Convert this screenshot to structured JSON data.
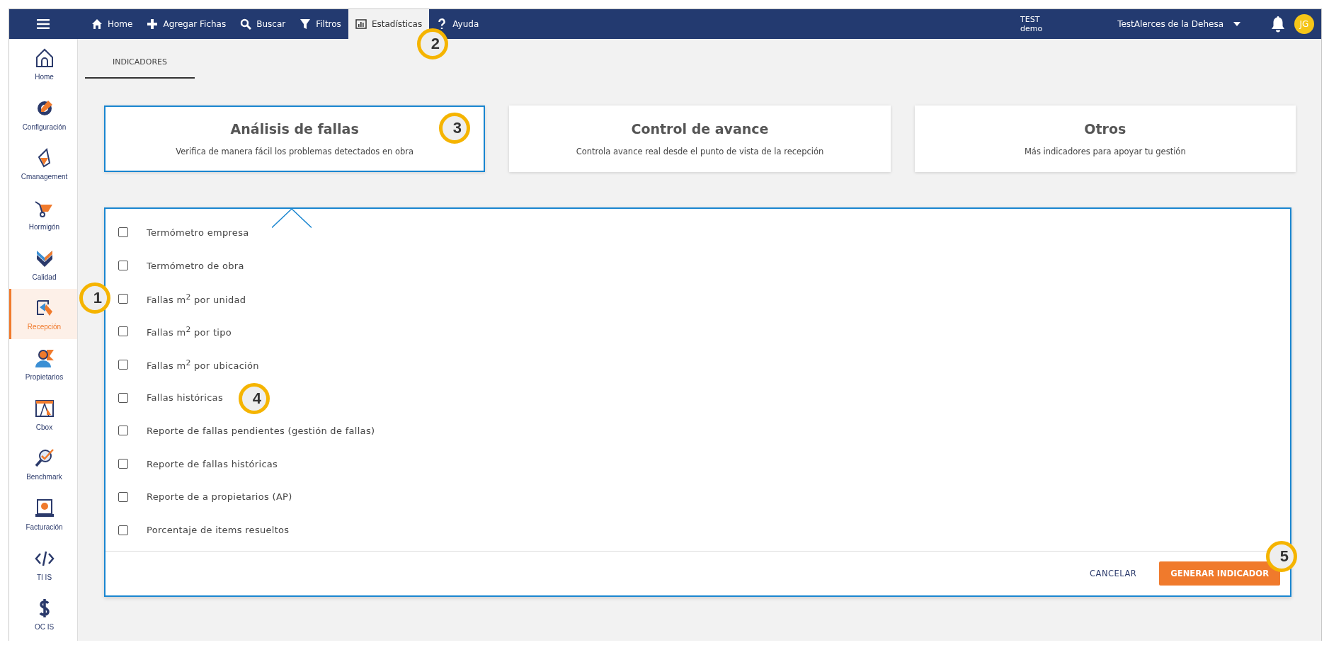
{
  "topbar": {
    "nav": [
      {
        "label": "Home",
        "selected": false
      },
      {
        "label": "Agregar Fichas",
        "selected": false
      },
      {
        "label": "Buscar",
        "selected": false
      },
      {
        "label": "Filtros",
        "selected": false
      },
      {
        "label": "Estadísticas",
        "selected": true
      },
      {
        "label": "Ayuda",
        "selected": false
      }
    ],
    "env": [
      "TEST",
      "demo"
    ],
    "project": "TestAlerces de la Dehesa",
    "avatar": "JG"
  },
  "sidebar": {
    "items": [
      {
        "label": "Home",
        "selected": false
      },
      {
        "label": "Configuración",
        "selected": false
      },
      {
        "label": "Cmanagement",
        "selected": false
      },
      {
        "label": "Hormigón",
        "selected": false
      },
      {
        "label": "Calidad",
        "selected": false
      },
      {
        "label": "Recepción",
        "selected": true
      },
      {
        "label": "Propietarios",
        "selected": false
      },
      {
        "label": "Cbox",
        "selected": false
      },
      {
        "label": "Benchmark",
        "selected": false
      },
      {
        "label": "Facturación",
        "selected": false
      },
      {
        "label": "TI IS",
        "selected": false
      },
      {
        "label": "OC IS",
        "selected": false
      }
    ]
  },
  "tabs": [
    {
      "label": "INDICADORES",
      "selected": true
    }
  ],
  "cards": [
    {
      "title": "Análisis de fallas",
      "subtitle": "Verifica de manera fácil los problemas detectados en obra",
      "selected": true
    },
    {
      "title": "Control de avance",
      "subtitle": "Controla avance real desde el punto de vista de la recepción",
      "selected": false
    },
    {
      "title": "Otros",
      "subtitle": "Más indicadores para apoyar tu gestión",
      "selected": false
    }
  ],
  "indicators": [
    {
      "label": "Termómetro empresa",
      "checked": false
    },
    {
      "label": "Termómetro de obra",
      "checked": false
    },
    {
      "label": "Fallas m$^{2}$ por unidad",
      "checked": false
    },
    {
      "label": "Fallas m$^{2}$ por tipo",
      "checked": false
    },
    {
      "label": "Fallas m$^{2}$ por ubicación",
      "checked": false
    },
    {
      "label": "Fallas históricas",
      "checked": false
    },
    {
      "label": "Reporte de fallas pendientes (gestión de fallas)",
      "checked": false
    },
    {
      "label": "Reporte de fallas históricas",
      "checked": false
    },
    {
      "label": "Reporte de a propietarios (AP)",
      "checked": false
    },
    {
      "label": "Porcentaje de items resueltos",
      "checked": false
    }
  ],
  "actions": {
    "cancel": "CANCELAR",
    "submit": "GENERAR INDICADOR"
  },
  "callouts": [
    "1",
    "2",
    "3",
    "4",
    "5"
  ]
}
